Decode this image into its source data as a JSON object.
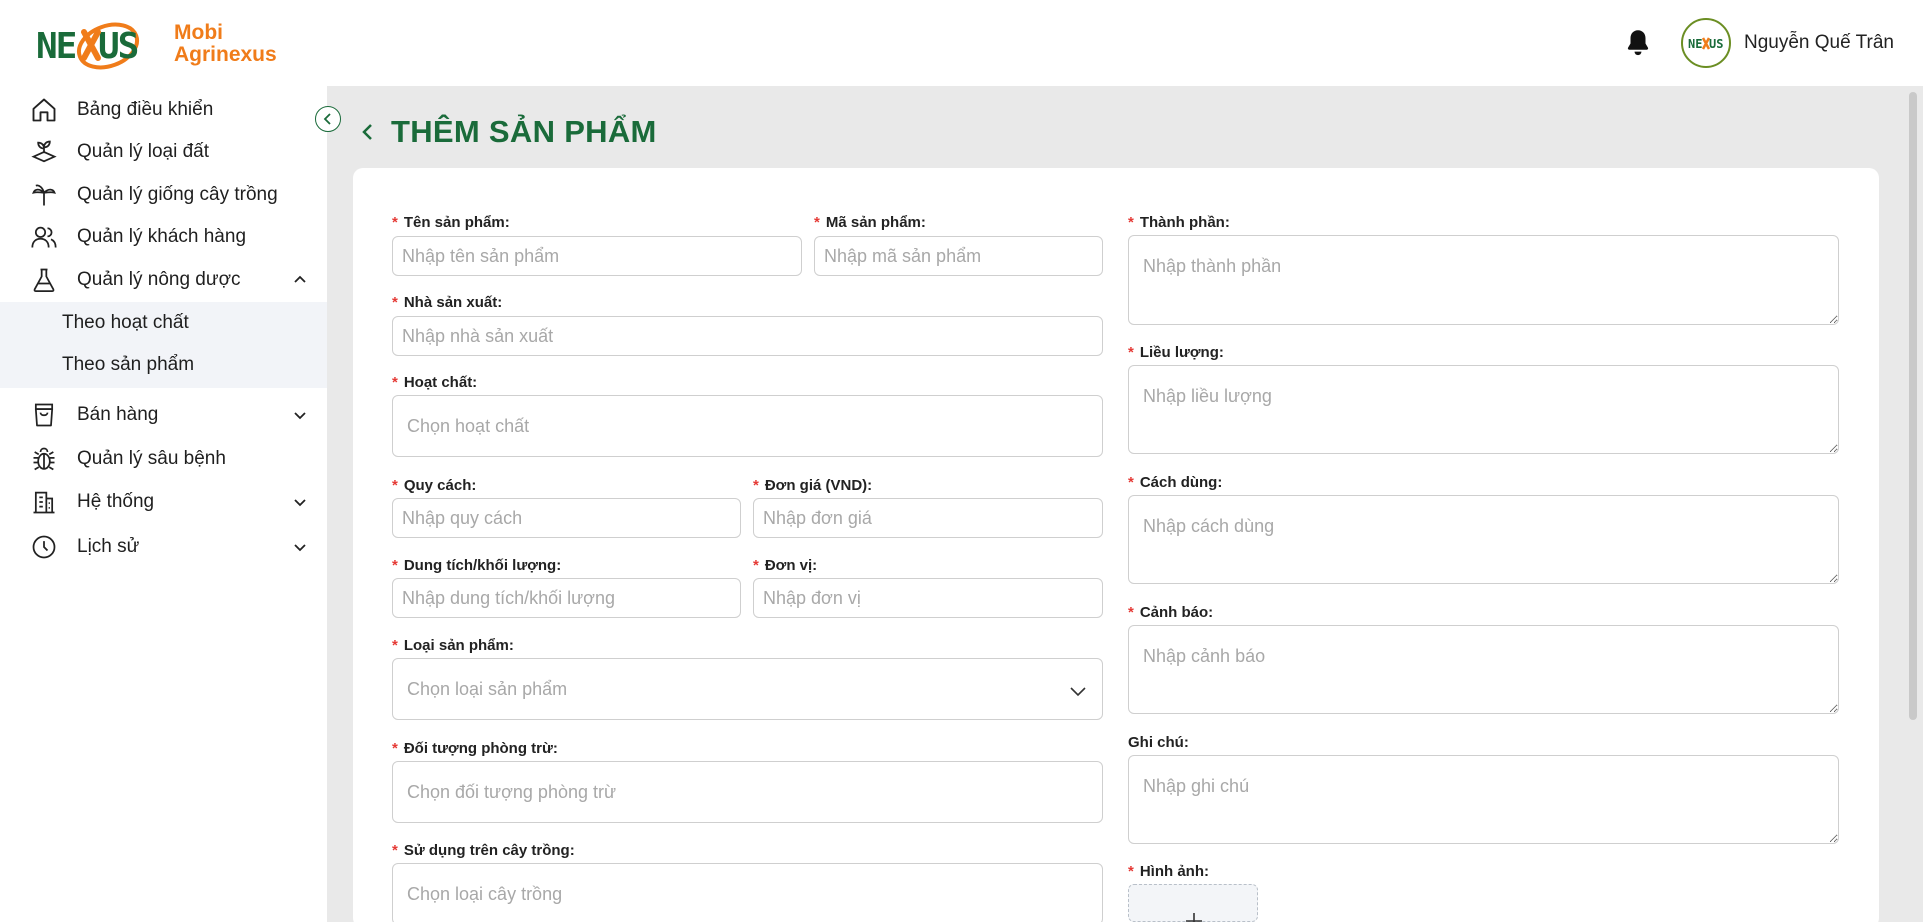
{
  "header": {
    "logo_word": "NEXUS",
    "brand_line1": "Mobi",
    "brand_line2": "Agrinexus",
    "user_name": "Nguyễn Quế Trân",
    "colors": {
      "brand_green": "#1a6b3a",
      "brand_orange": "#f07c1a"
    }
  },
  "sidebar": {
    "items": [
      {
        "label": "Bảng điều khiển",
        "icon": "home-icon"
      },
      {
        "label": "Quản lý loại đất",
        "icon": "soil-icon"
      },
      {
        "label": "Quản lý giống cây trồng",
        "icon": "plant-icon"
      },
      {
        "label": "Quản lý khách hàng",
        "icon": "users-icon"
      },
      {
        "label": "Quản lý nông dược",
        "icon": "flask-icon",
        "expanded": true
      },
      {
        "label": "Bán hàng",
        "icon": "shopping-bag-icon"
      },
      {
        "label": "Quản lý sâu bệnh",
        "icon": "bug-icon"
      },
      {
        "label": "Hệ thống",
        "icon": "building-icon"
      },
      {
        "label": "Lịch sử",
        "icon": "clock-icon"
      }
    ],
    "subitems": [
      {
        "label": "Theo hoạt chất"
      },
      {
        "label": "Theo sản phẩm"
      }
    ]
  },
  "page": {
    "title": "THÊM SẢN PHẨM"
  },
  "form": {
    "ten_san_pham": {
      "label": "Tên sản phẩm:",
      "placeholder": "Nhập tên sản phẩm"
    },
    "ma_san_pham": {
      "label": "Mã sản phẩm:",
      "placeholder": "Nhập mã sản phẩm"
    },
    "nha_san_xuat": {
      "label": "Nhà sản xuất:",
      "placeholder": "Nhập nhà sản xuất"
    },
    "hoat_chat": {
      "label": "Hoạt chất:",
      "placeholder": "Chọn hoạt chất"
    },
    "quy_cach": {
      "label": "Quy cách:",
      "placeholder": "Nhập quy cách"
    },
    "don_gia": {
      "label": "Đơn giá (VND):",
      "placeholder": "Nhập đơn giá"
    },
    "dung_tich": {
      "label": "Dung tích/khối lượng:",
      "placeholder": "Nhập dung tích/khối lượng"
    },
    "don_vi": {
      "label": "Đơn vị:",
      "placeholder": "Nhập đơn vị"
    },
    "loai_san_pham": {
      "label": "Loại sản phẩm:",
      "placeholder": "Chọn loại sản phẩm"
    },
    "doi_tuong": {
      "label": "Đối tượng phòng trừ:",
      "placeholder": "Chọn đối tượng phòng trừ"
    },
    "su_dung": {
      "label": "Sử dụng trên cây trồng:",
      "placeholder": "Chọn loại cây trồng"
    },
    "thanh_phan": {
      "label": "Thành phần:",
      "placeholder": "Nhập thành phần"
    },
    "lieu_luong": {
      "label": "Liều lượng:",
      "placeholder": "Nhập liều lượng"
    },
    "cach_dung": {
      "label": "Cách dùng:",
      "placeholder": "Nhập cách dùng"
    },
    "canh_bao": {
      "label": "Cảnh báo:",
      "placeholder": "Nhập cảnh báo"
    },
    "ghi_chu": {
      "label": "Ghi chú:",
      "placeholder": "Nhập ghi chú"
    },
    "hinh_anh": {
      "label": "Hình ảnh:"
    },
    "required_mark": "*"
  }
}
